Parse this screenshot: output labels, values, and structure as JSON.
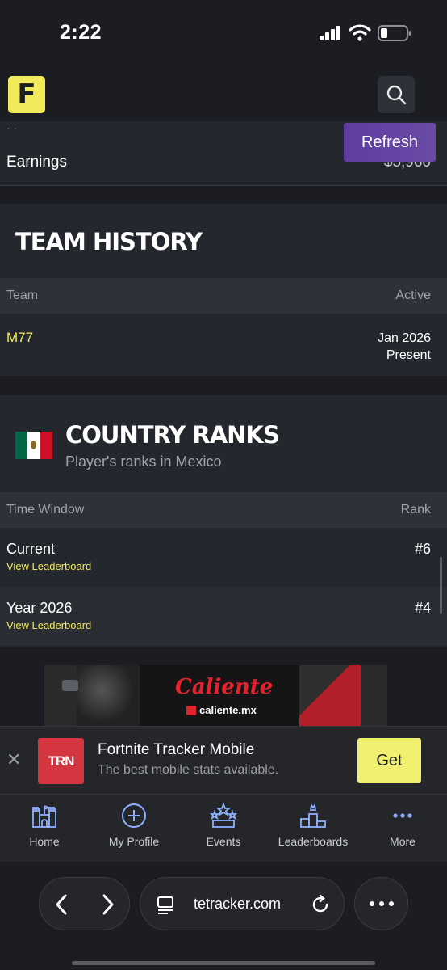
{
  "status_bar": {
    "time": "2:22"
  },
  "header": {
    "logo_text": "F"
  },
  "earnings": {
    "label": "Earnings",
    "value": "$5,960",
    "faded_text": "· ·"
  },
  "refresh_label": "Refresh",
  "team_history": {
    "title": "TEAM HISTORY",
    "col_team": "Team",
    "col_active": "Active",
    "team_name": "M77",
    "date_start": "Jan 2026",
    "date_end": "Present"
  },
  "country_ranks": {
    "title": "COUNTRY RANKS",
    "subtitle": "Player's ranks in Mexico",
    "col_window": "Time Window",
    "col_rank": "Rank",
    "rows": [
      {
        "label": "Current",
        "link": "View Leaderboard",
        "rank": "#6"
      },
      {
        "label": "Year 2026",
        "link": "View Leaderboard",
        "rank": "#4"
      }
    ],
    "flag_colors": [
      "#006847",
      "#ffffff",
      "#ce1126"
    ]
  },
  "ad": {
    "brand": "Caliente",
    "url": "caliente.mx"
  },
  "promo": {
    "logo": "TRN",
    "title": "Fortnite Tracker Mobile",
    "subtitle": "The best mobile stats available.",
    "button": "Get"
  },
  "bottom_nav": {
    "home": "Home",
    "profile": "My Profile",
    "events": "Events",
    "leaderboards": "Leaderboards",
    "more": "More"
  },
  "browser": {
    "url": "tetracker.com"
  },
  "colors": {
    "accent_yellow": "#f1ea5a",
    "nav_blue": "#8fb0ff",
    "refresh_purple": "#5d3ea0"
  }
}
